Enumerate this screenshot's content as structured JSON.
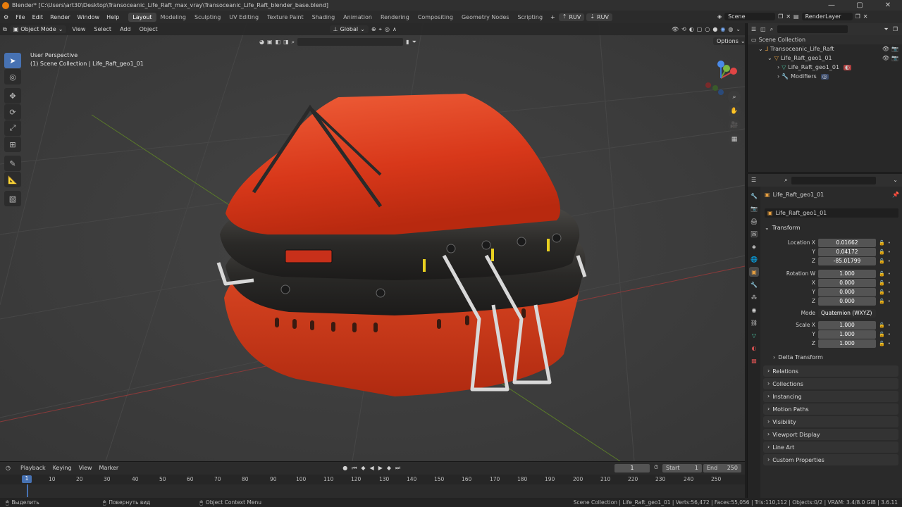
{
  "title_bar": {
    "text": "Blender* [C:\\Users\\art30\\Desktop\\Transoceanic_Life_Raft_max_vray\\Transoceanic_Life_Raft_blender_base.blend]"
  },
  "menu": {
    "items": [
      "File",
      "Edit",
      "Render",
      "Window",
      "Help"
    ]
  },
  "workspaces": [
    "Layout",
    "Modeling",
    "Sculpting",
    "UV Editing",
    "Texture Paint",
    "Shading",
    "Animation",
    "Rendering",
    "Compositing",
    "Geometry Nodes",
    "Scripting"
  ],
  "addons": {
    "ruv1": "RUV",
    "ruv2": "RUV"
  },
  "scene": {
    "name": "Scene",
    "render_layer": "RenderLayer"
  },
  "viewport_header": {
    "mode": "Object Mode",
    "menus": [
      "View",
      "Select",
      "Add",
      "Object"
    ],
    "orientation": "Global",
    "options": "Options"
  },
  "viewport_info": {
    "perspective": "User Perspective",
    "collection": "(1) Scene Collection | Life_Raft_geo1_01"
  },
  "outliner": {
    "root": "Scene Collection",
    "items": [
      {
        "label": "Transoceanic_Life_Raft"
      },
      {
        "label": "Life_Raft_geo1_01"
      },
      {
        "label": "Life_Raft_geo1_01"
      },
      {
        "label": "Modifiers"
      }
    ]
  },
  "properties": {
    "object_name": "Life_Raft_geo1_01",
    "datablock": "Life_Raft_geo1_01",
    "transform_title": "Transform",
    "location": {
      "label": "Location X",
      "x": "0.01662",
      "y_label": "Y",
      "y": "0.04172",
      "z_label": "Z",
      "z": "-85.01799"
    },
    "rotation": {
      "label": "Rotation W",
      "w": "1.000",
      "x_label": "X",
      "x": "0.000",
      "y_label": "Y",
      "y": "0.000",
      "z_label": "Z",
      "z": "0.000"
    },
    "mode": {
      "label": "Mode",
      "value": "Quaternion (WXYZ)"
    },
    "scale": {
      "label": "Scale X",
      "x": "1.000",
      "y_label": "Y",
      "y": "1.000",
      "z_label": "Z",
      "z": "1.000"
    },
    "delta": "Delta Transform",
    "panels": [
      "Relations",
      "Collections",
      "Instancing",
      "Motion Paths",
      "Visibility",
      "Viewport Display",
      "Line Art",
      "Custom Properties"
    ]
  },
  "timeline": {
    "menus": [
      "Playback",
      "Keying",
      "View",
      "Marker"
    ],
    "current_frame": "1",
    "start_label": "Start",
    "start": "1",
    "end_label": "End",
    "end": "250",
    "ticks": [
      "1",
      "10",
      "20",
      "30",
      "40",
      "50",
      "60",
      "70",
      "80",
      "90",
      "100",
      "110",
      "120",
      "130",
      "140",
      "150",
      "160",
      "170",
      "180",
      "190",
      "200",
      "210",
      "220",
      "230",
      "240",
      "250"
    ]
  },
  "statusbar": {
    "select": "Выделить",
    "rotate": "Повернуть вид",
    "context": "Object Context Menu",
    "stats": "Scene Collection | Life_Raft_geo1_01 | Verts:56,472 | Faces:55,056 | Tris:110,112 | Objects:0/2 | VRAM: 3.4/8.0 GiB | 3.6.11"
  },
  "colors": {
    "accent": "#4772b3",
    "raft_orange": "#e0441f",
    "tube_dark": "#2b2a28",
    "blender_orange": "#e87d0d"
  }
}
